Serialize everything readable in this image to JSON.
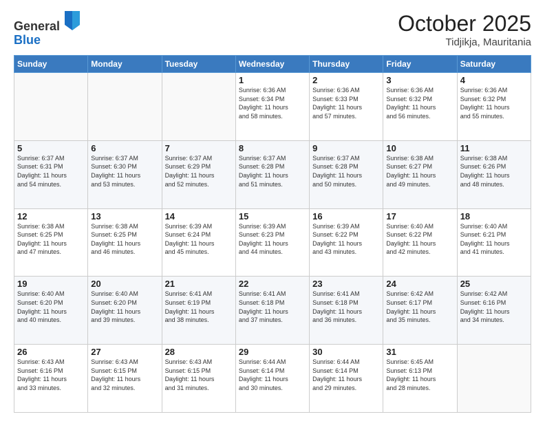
{
  "header": {
    "logo_general": "General",
    "logo_blue": "Blue",
    "month": "October 2025",
    "location": "Tidjikja, Mauritania"
  },
  "weekdays": [
    "Sunday",
    "Monday",
    "Tuesday",
    "Wednesday",
    "Thursday",
    "Friday",
    "Saturday"
  ],
  "weeks": [
    [
      {
        "day": "",
        "info": ""
      },
      {
        "day": "",
        "info": ""
      },
      {
        "day": "",
        "info": ""
      },
      {
        "day": "1",
        "info": "Sunrise: 6:36 AM\nSunset: 6:34 PM\nDaylight: 11 hours\nand 58 minutes."
      },
      {
        "day": "2",
        "info": "Sunrise: 6:36 AM\nSunset: 6:33 PM\nDaylight: 11 hours\nand 57 minutes."
      },
      {
        "day": "3",
        "info": "Sunrise: 6:36 AM\nSunset: 6:32 PM\nDaylight: 11 hours\nand 56 minutes."
      },
      {
        "day": "4",
        "info": "Sunrise: 6:36 AM\nSunset: 6:32 PM\nDaylight: 11 hours\nand 55 minutes."
      }
    ],
    [
      {
        "day": "5",
        "info": "Sunrise: 6:37 AM\nSunset: 6:31 PM\nDaylight: 11 hours\nand 54 minutes."
      },
      {
        "day": "6",
        "info": "Sunrise: 6:37 AM\nSunset: 6:30 PM\nDaylight: 11 hours\nand 53 minutes."
      },
      {
        "day": "7",
        "info": "Sunrise: 6:37 AM\nSunset: 6:29 PM\nDaylight: 11 hours\nand 52 minutes."
      },
      {
        "day": "8",
        "info": "Sunrise: 6:37 AM\nSunset: 6:28 PM\nDaylight: 11 hours\nand 51 minutes."
      },
      {
        "day": "9",
        "info": "Sunrise: 6:37 AM\nSunset: 6:28 PM\nDaylight: 11 hours\nand 50 minutes."
      },
      {
        "day": "10",
        "info": "Sunrise: 6:38 AM\nSunset: 6:27 PM\nDaylight: 11 hours\nand 49 minutes."
      },
      {
        "day": "11",
        "info": "Sunrise: 6:38 AM\nSunset: 6:26 PM\nDaylight: 11 hours\nand 48 minutes."
      }
    ],
    [
      {
        "day": "12",
        "info": "Sunrise: 6:38 AM\nSunset: 6:25 PM\nDaylight: 11 hours\nand 47 minutes."
      },
      {
        "day": "13",
        "info": "Sunrise: 6:38 AM\nSunset: 6:25 PM\nDaylight: 11 hours\nand 46 minutes."
      },
      {
        "day": "14",
        "info": "Sunrise: 6:39 AM\nSunset: 6:24 PM\nDaylight: 11 hours\nand 45 minutes."
      },
      {
        "day": "15",
        "info": "Sunrise: 6:39 AM\nSunset: 6:23 PM\nDaylight: 11 hours\nand 44 minutes."
      },
      {
        "day": "16",
        "info": "Sunrise: 6:39 AM\nSunset: 6:22 PM\nDaylight: 11 hours\nand 43 minutes."
      },
      {
        "day": "17",
        "info": "Sunrise: 6:40 AM\nSunset: 6:22 PM\nDaylight: 11 hours\nand 42 minutes."
      },
      {
        "day": "18",
        "info": "Sunrise: 6:40 AM\nSunset: 6:21 PM\nDaylight: 11 hours\nand 41 minutes."
      }
    ],
    [
      {
        "day": "19",
        "info": "Sunrise: 6:40 AM\nSunset: 6:20 PM\nDaylight: 11 hours\nand 40 minutes."
      },
      {
        "day": "20",
        "info": "Sunrise: 6:40 AM\nSunset: 6:20 PM\nDaylight: 11 hours\nand 39 minutes."
      },
      {
        "day": "21",
        "info": "Sunrise: 6:41 AM\nSunset: 6:19 PM\nDaylight: 11 hours\nand 38 minutes."
      },
      {
        "day": "22",
        "info": "Sunrise: 6:41 AM\nSunset: 6:18 PM\nDaylight: 11 hours\nand 37 minutes."
      },
      {
        "day": "23",
        "info": "Sunrise: 6:41 AM\nSunset: 6:18 PM\nDaylight: 11 hours\nand 36 minutes."
      },
      {
        "day": "24",
        "info": "Sunrise: 6:42 AM\nSunset: 6:17 PM\nDaylight: 11 hours\nand 35 minutes."
      },
      {
        "day": "25",
        "info": "Sunrise: 6:42 AM\nSunset: 6:16 PM\nDaylight: 11 hours\nand 34 minutes."
      }
    ],
    [
      {
        "day": "26",
        "info": "Sunrise: 6:43 AM\nSunset: 6:16 PM\nDaylight: 11 hours\nand 33 minutes."
      },
      {
        "day": "27",
        "info": "Sunrise: 6:43 AM\nSunset: 6:15 PM\nDaylight: 11 hours\nand 32 minutes."
      },
      {
        "day": "28",
        "info": "Sunrise: 6:43 AM\nSunset: 6:15 PM\nDaylight: 11 hours\nand 31 minutes."
      },
      {
        "day": "29",
        "info": "Sunrise: 6:44 AM\nSunset: 6:14 PM\nDaylight: 11 hours\nand 30 minutes."
      },
      {
        "day": "30",
        "info": "Sunrise: 6:44 AM\nSunset: 6:14 PM\nDaylight: 11 hours\nand 29 minutes."
      },
      {
        "day": "31",
        "info": "Sunrise: 6:45 AM\nSunset: 6:13 PM\nDaylight: 11 hours\nand 28 minutes."
      },
      {
        "day": "",
        "info": ""
      }
    ]
  ]
}
